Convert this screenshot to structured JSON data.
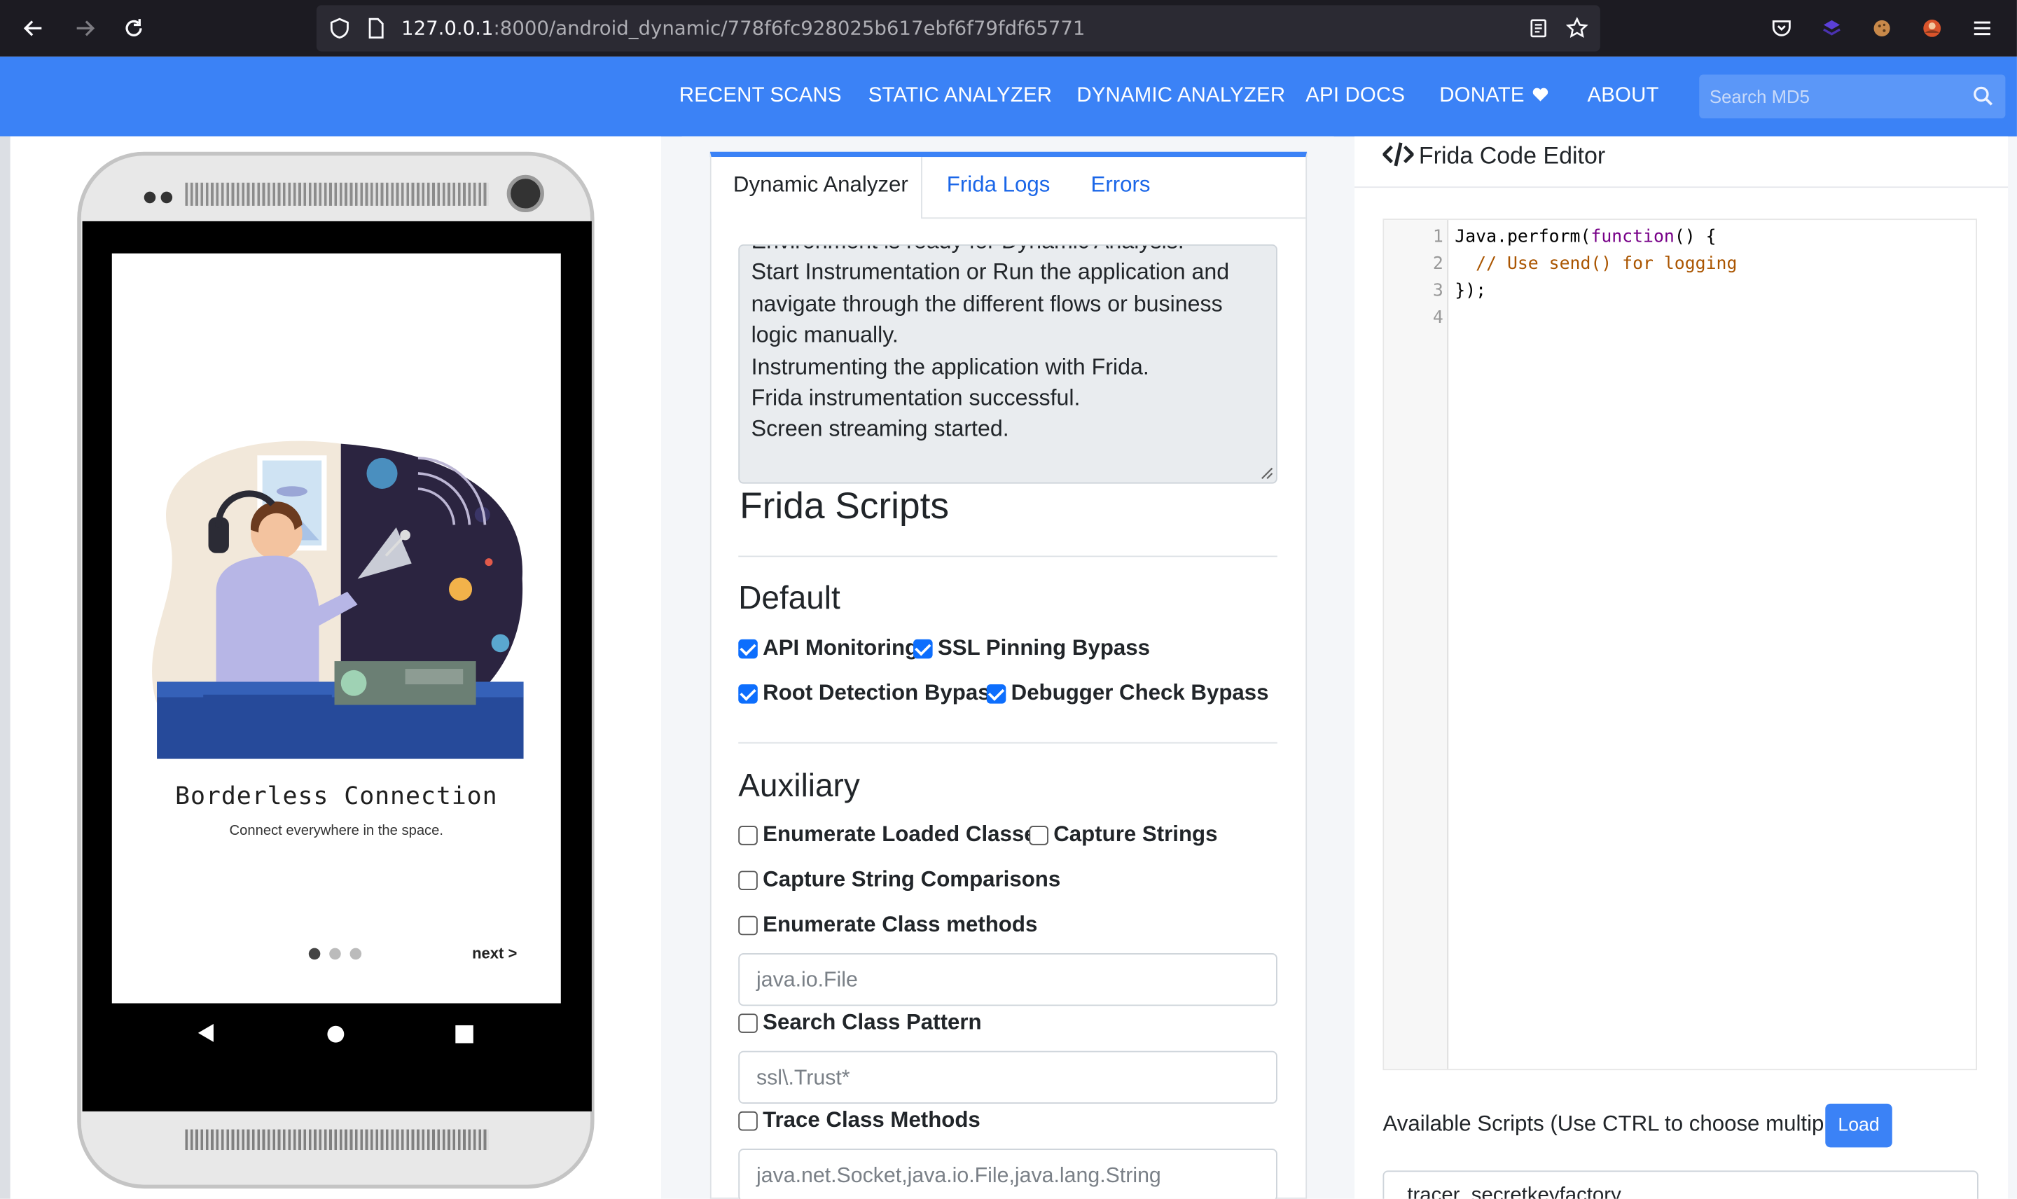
{
  "browser": {
    "url_host": "127.0.0.1",
    "url_path": ":8000/android_dynamic/778f6fc928025b617ebf6f79fdf65771"
  },
  "navbar": {
    "items": [
      "RECENT SCANS",
      "STATIC ANALYZER",
      "DYNAMIC ANALYZER",
      "API DOCS",
      "DONATE",
      "ABOUT"
    ],
    "search_placeholder": "Search MD5"
  },
  "phone": {
    "app_title": "Borderless Connection",
    "app_subtitle": "Connect everywhere in the space.",
    "next_label": "next >",
    "page_dots": 3,
    "active_dot": 1
  },
  "tabs": {
    "items": [
      "Dynamic Analyzer",
      "Frida Logs",
      "Errors"
    ],
    "active": "Dynamic Analyzer"
  },
  "log": {
    "lines": [
      "Environment is ready for Dynamic Analysis.",
      "Start Instrumentation or Run the application and",
      "navigate through the different flows or business",
      "logic manually.",
      "Instrumenting the application with Frida.",
      "Frida instrumentation successful.",
      "Screen streaming started."
    ]
  },
  "frida": {
    "heading": "Frida Scripts",
    "default_heading": "Default",
    "default_scripts": [
      {
        "label": "API Monitoring",
        "checked": true
      },
      {
        "label": "SSL Pinning Bypass",
        "checked": true
      },
      {
        "label": "Root Detection Bypass",
        "checked": true
      },
      {
        "label": "Debugger Check Bypass",
        "checked": true
      }
    ],
    "aux_heading": "Auxiliary",
    "aux_scripts": [
      {
        "label": "Enumerate Loaded Classes",
        "checked": false
      },
      {
        "label": "Capture Strings",
        "checked": false
      },
      {
        "label": "Capture String Comparisons",
        "checked": false
      },
      {
        "label": "Enumerate Class methods",
        "checked": false
      },
      {
        "label": "Search Class Pattern",
        "checked": false
      },
      {
        "label": "Trace Class Methods",
        "checked": false
      }
    ],
    "class_methods_placeholder": "java.io.File",
    "search_pattern_placeholder": "ssl\\.Trust*",
    "trace_placeholder": "java.net.Socket,java.io.File,java.lang.String"
  },
  "editor": {
    "title": "Frida Code Editor",
    "line_numbers": [
      "1",
      "2",
      "3",
      "4"
    ],
    "code": {
      "l1_a": "Java.perform(",
      "l1_kw": "function",
      "l1_b": "() {",
      "l2_comment": "  // Use send() for logging",
      "l3": "});"
    },
    "available_label": "Available Scripts (Use CTRL to choose multiple)",
    "load_label": "Load",
    "first_script": "tracer_secretkeyfactory"
  },
  "colors": {
    "accent": "#3b82f6",
    "checkbox": "#0d6efd",
    "browser_chrome": "#1c1b22"
  }
}
